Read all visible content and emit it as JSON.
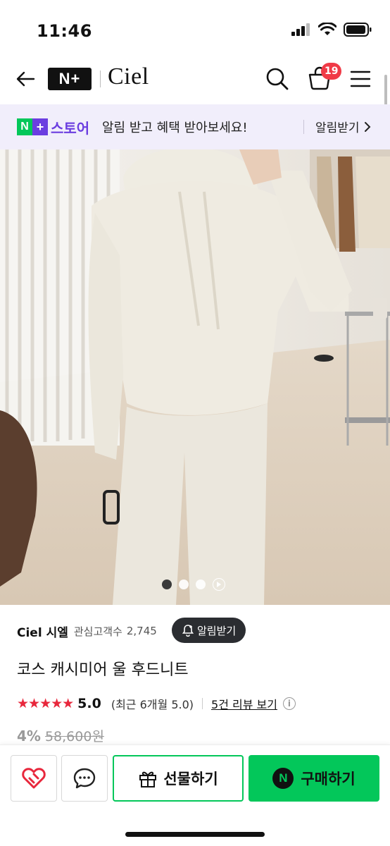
{
  "status_bar": {
    "time": "11:46"
  },
  "header": {
    "logo_badge": "N+",
    "brand_name": "Ciel",
    "cart_count": "19"
  },
  "promo": {
    "logo_n": "N",
    "logo_plus": "+",
    "store_label": "스토어",
    "text": "알림 받고 혜택 받아보세요!",
    "cta": "알림받기"
  },
  "product": {
    "store_name": "Ciel 시엘",
    "follower_label": "관심고객수",
    "follower_count": "2,745",
    "alarm_button": "알림받기",
    "title": "코스 캐시미어 울 후드니트",
    "stars": "★★★★★",
    "rating": "5.0",
    "rating_recent": "(최근 6개월 5.0)",
    "review_link": "5건 리뷰 보기",
    "discount": "4%",
    "original_price": "58,600원"
  },
  "carousel": {
    "total_dots": 3,
    "active_index": 0
  },
  "bottom_bar": {
    "gift_label": "선물하기",
    "buy_label": "구매하기",
    "npay_letter": "N"
  },
  "colors": {
    "naver_green": "#03c75a",
    "plus_purple": "#6b3ee0",
    "badge_red": "#f03a47",
    "star_red": "#e8273c"
  }
}
